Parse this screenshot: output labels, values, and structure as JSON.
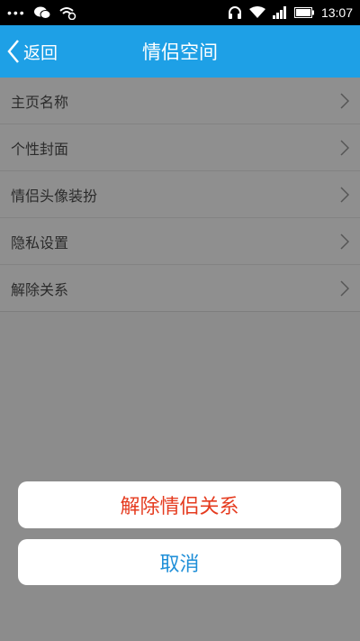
{
  "status_bar": {
    "time": "13:07",
    "icons": [
      "more-dots-icon",
      "wechat-icon",
      "wifi-sync-icon",
      "headset-icon",
      "wifi-icon",
      "signal-icon",
      "battery-icon"
    ]
  },
  "app_bar": {
    "back_label": "返回",
    "title": "情侣空间"
  },
  "list": {
    "items": [
      {
        "label": "主页名称"
      },
      {
        "label": "个性封面"
      },
      {
        "label": "情侣头像装扮"
      },
      {
        "label": "隐私设置"
      },
      {
        "label": "解除关系"
      }
    ]
  },
  "action_sheet": {
    "confirm_label": "解除情侣关系",
    "cancel_label": "取消"
  },
  "colors": {
    "app_bar": "#1ea0e6",
    "danger": "#e53b1f",
    "cancel": "#1f8fd8",
    "dim_background": "#8c8c8c"
  }
}
